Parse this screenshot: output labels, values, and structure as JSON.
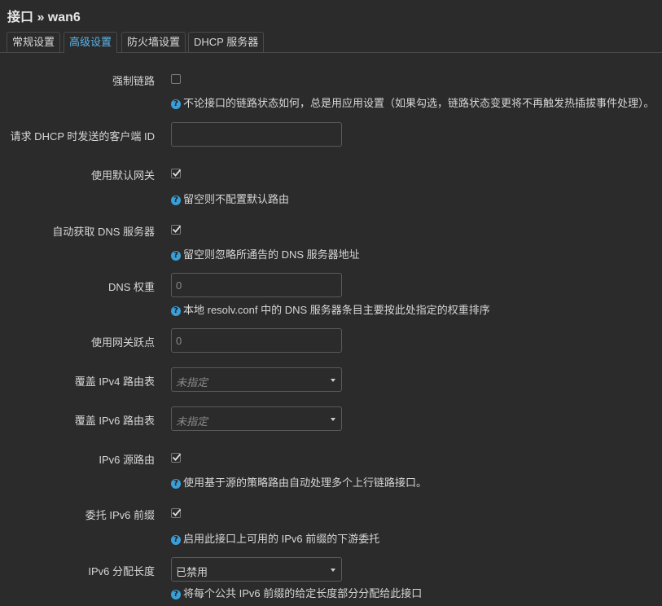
{
  "page": {
    "title": "接口 » wan6"
  },
  "tabs": [
    {
      "label": "常规设置"
    },
    {
      "label": "高级设置"
    },
    {
      "label": "防火墙设置"
    },
    {
      "label": "DHCP 服务器"
    }
  ],
  "form": {
    "force_link": {
      "label": "强制链路",
      "checked": false,
      "help": "不论接口的链路状态如何，总是用应用设置（如果勾选，链路状态变更将不再触发热插拔事件处理）。"
    },
    "client_id": {
      "label": "请求 DHCP 时发送的客户端 ID",
      "value": ""
    },
    "default_gateway": {
      "label": "使用默认网关",
      "checked": true,
      "help": "留空则不配置默认路由"
    },
    "peer_dns": {
      "label": "自动获取 DNS 服务器",
      "checked": true,
      "help": "留空则忽略所通告的 DNS 服务器地址"
    },
    "dns_weight": {
      "label": "DNS 权重",
      "placeholder": "0",
      "help": "本地 resolv.conf 中的 DNS 服务器条目主要按此处指定的权重排序"
    },
    "gateway_metric": {
      "label": "使用网关跃点",
      "placeholder": "0"
    },
    "ipv4_table": {
      "label": "覆盖 IPv4 路由表",
      "value": "未指定"
    },
    "ipv6_table": {
      "label": "覆盖 IPv6 路由表",
      "value": "未指定"
    },
    "source_routing": {
      "label": "IPv6 源路由",
      "checked": true,
      "help": "使用基于源的策略路由自动处理多个上行链路接口。"
    },
    "delegate": {
      "label": "委托 IPv6 前缀",
      "checked": true,
      "help": "启用此接口上可用的 IPv6 前缀的下游委托"
    },
    "ip6assign": {
      "label": "IPv6 分配长度",
      "value": "已禁用",
      "help": "将每个公共 IPv6 前缀的给定长度部分分配给此接口"
    }
  },
  "colors": {
    "background": "#2b2b2b",
    "accent": "#5ab4e8",
    "help_icon": "#3a9fd8"
  }
}
